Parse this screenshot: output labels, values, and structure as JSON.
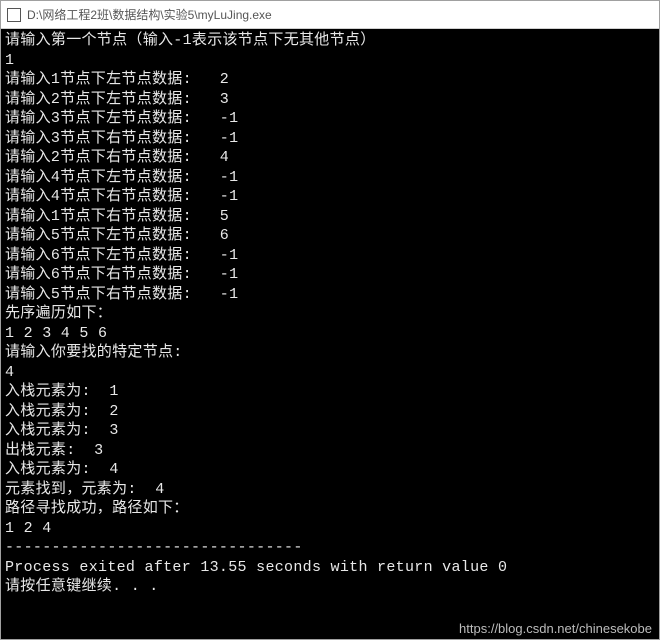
{
  "window": {
    "title_path": "D:\\网络工程2班\\数据结构\\实验5\\myLuJing.exe"
  },
  "console": {
    "lines": [
      "请输入第一个节点（输入-1表示该节点下无其他节点）",
      "1",
      "请输入1节点下左节点数据:   2",
      "请输入2节点下左节点数据:   3",
      "请输入3节点下左节点数据:   -1",
      "请输入3节点下右节点数据:   -1",
      "请输入2节点下右节点数据:   4",
      "请输入4节点下左节点数据:   -1",
      "请输入4节点下右节点数据:   -1",
      "请输入1节点下右节点数据:   5",
      "请输入5节点下左节点数据:   6",
      "请输入6节点下左节点数据:   -1",
      "请输入6节点下右节点数据:   -1",
      "请输入5节点下右节点数据:   -1",
      "先序遍历如下：",
      "1 2 3 4 5 6",
      "请输入你要找的特定节点:",
      "4",
      "入栈元素为:  1",
      "入栈元素为:  2",
      "入栈元素为:  3",
      "出栈元素:  3",
      "入栈元素为:  4",
      "元素找到，元素为:  4",
      "路径寻找成功，路径如下：",
      "1 2 4",
      "--------------------------------",
      "Process exited after 13.55 seconds with return value 0",
      "请按任意键继续. . ."
    ]
  },
  "watermark": {
    "text": "https://blog.csdn.net/chinesekobe"
  }
}
